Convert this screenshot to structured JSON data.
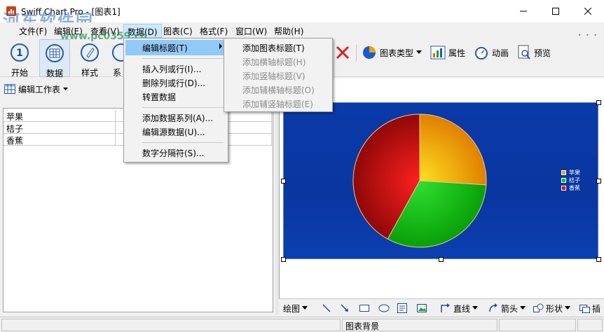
{
  "window": {
    "title": "Swiff Chart Pro - [图表1]",
    "watermark": "河东软件园",
    "watermark_url": "www.pc0359.cn"
  },
  "menubar": {
    "items": [
      {
        "label": "文件(F)",
        "icon": "file"
      },
      {
        "label": "编辑(E)"
      },
      {
        "label": "查看(V)"
      },
      {
        "label": "数据(D)"
      },
      {
        "label": "图表(C)"
      },
      {
        "label": "格式(F)"
      },
      {
        "label": "窗口(W)"
      },
      {
        "label": "帮助(H)"
      }
    ]
  },
  "toolbar": {
    "big": [
      {
        "label": "开始",
        "icon": "step-one-icon"
      },
      {
        "label": "数据",
        "icon": "data-grid-icon"
      },
      {
        "label": "样式",
        "icon": "brush-icon"
      },
      {
        "label": "系",
        "icon": "series-icon"
      }
    ],
    "chart_type_label": "图表类型",
    "properties_label": "属性",
    "animation_label": "动画",
    "preview_label": "预览"
  },
  "worksheet": {
    "header_label": "编辑工作表",
    "rows": [
      "苹果",
      "桔子",
      "香蕉"
    ]
  },
  "data_menu": {
    "items": [
      {
        "label": "编辑标题(T)",
        "submenu": true,
        "highlighted": true
      },
      {
        "label": "插入列或行(I)..."
      },
      {
        "label": "删除列或行(D)..."
      },
      {
        "label": "转置数据"
      },
      {
        "label": "添加数据系列(A)..."
      },
      {
        "label": "编辑源数据(U)..."
      },
      {
        "label": "数字分隔符(S)..."
      }
    ]
  },
  "title_submenu": {
    "items": [
      {
        "label": "添加图表标题(T)",
        "enabled": true
      },
      {
        "label": "添加横轴标题(H)",
        "enabled": false
      },
      {
        "label": "添加竖轴标题(V)",
        "enabled": false
      },
      {
        "label": "添加辅横轴标题(O)",
        "enabled": false
      },
      {
        "label": "添加辅竖轴标题(E)",
        "enabled": false
      }
    ]
  },
  "chart_data": {
    "type": "pie",
    "categories": [
      "苹果",
      "桔子",
      "香蕉"
    ],
    "values": [
      26,
      32,
      42
    ],
    "colors": [
      "#f0a000",
      "#10c010",
      "#d01010"
    ],
    "legend": "right"
  },
  "drawbar": {
    "draw_label": "绘图",
    "line_label": "直线",
    "arrow_label": "箭头",
    "shape_label": "形状",
    "insert_label": "插"
  },
  "status": {
    "panel_text": "图表背景"
  }
}
